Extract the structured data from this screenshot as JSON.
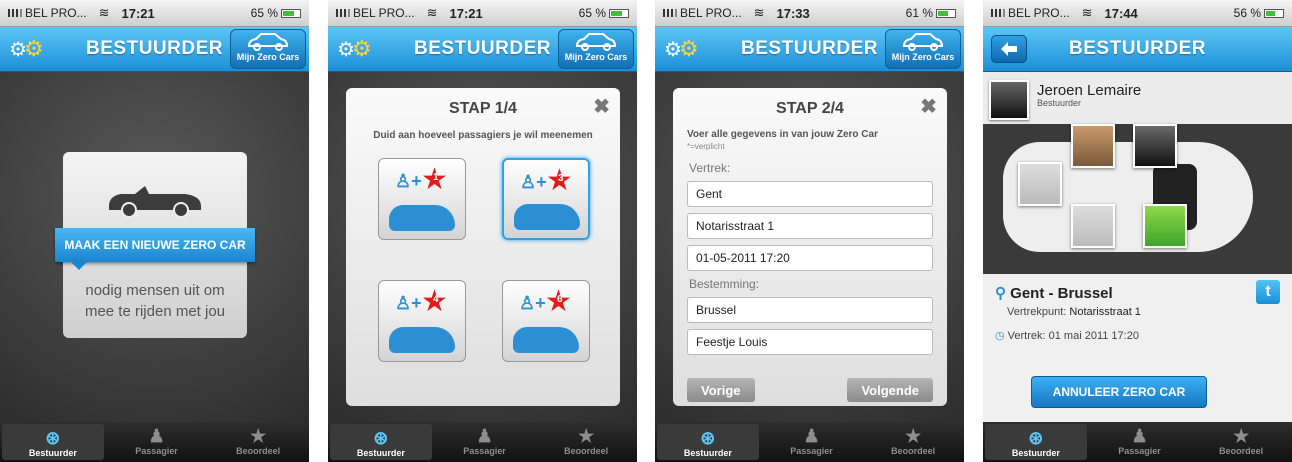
{
  "status_bars": [
    {
      "carrier": "BEL PRO...",
      "time": "17:21",
      "battery": "65 %",
      "battery_level": 0.65
    },
    {
      "carrier": "BEL PRO...",
      "time": "17:21",
      "battery": "65 %",
      "battery_level": 0.65
    },
    {
      "carrier": "BEL PRO...",
      "time": "17:33",
      "battery": "61 %",
      "battery_level": 0.61
    },
    {
      "carrier": "BEL PRO...",
      "time": "17:44",
      "battery": "56 %",
      "battery_level": 0.56
    }
  ],
  "navbar": {
    "title": "BESTUURDER",
    "my_cars_label": "Mijn Zero Cars"
  },
  "tabs": [
    "Bestuurder",
    "Passagier",
    "Beoordeel"
  ],
  "screen1": {
    "banner": "MAAK EEN NIEUWE ZERO CAR",
    "subtitle_line1": "nodig mensen uit om",
    "subtitle_line2": "mee te rijden met jou"
  },
  "screen2": {
    "title": "STAP 1/4",
    "subtitle": "Duid aan hoeveel passagiers je wil meenemen",
    "options": [
      "1",
      "3",
      "4",
      "6"
    ],
    "selected": "3"
  },
  "screen3": {
    "title": "STAP 2/4",
    "intro": "Voer alle gegevens in van jouw Zero Car",
    "required_note": "*=verplicht",
    "departure_label": "Vertrek:",
    "departure_city": "Gent",
    "departure_street": "Notarisstraat 1",
    "departure_datetime": "01-05-2011 17:20",
    "destination_label": "Bestemming:",
    "destination_city": "Brussel",
    "destination_place": "Feestje Louis",
    "prev_label": "Vorige",
    "next_label": "Volgende"
  },
  "screen4": {
    "driver_name": "Jeroen Lemaire",
    "driver_role": "Bestuurder",
    "route": "Gent - Brussel",
    "meeting_label": "Vertrekpunt:",
    "meeting_value": "Notarisstraat 1",
    "departure_label": "Vertrek:",
    "departure_value": "01 mai 2011 17:20",
    "cancel_label": "ANNULEER ZERO CAR",
    "twitter_letter": "t"
  },
  "colors": {
    "accent": "#1c8fd8",
    "star": "#e21b1b"
  }
}
